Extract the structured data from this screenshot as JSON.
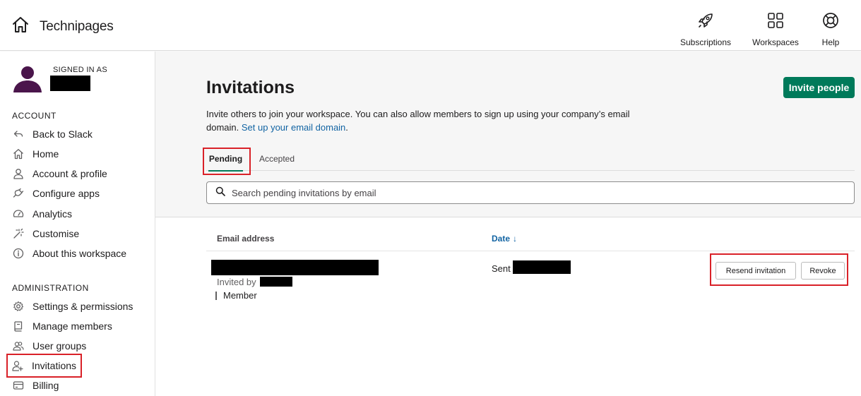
{
  "header": {
    "workspace_name": "Technipages",
    "home_icon": "home-icon",
    "nav": [
      {
        "label": "Subscriptions",
        "icon": "rocket-icon"
      },
      {
        "label": "Workspaces",
        "icon": "grid-icon"
      },
      {
        "label": "Help",
        "icon": "lifebuoy-icon"
      }
    ]
  },
  "sidebar": {
    "signed_in_label": "SIGNED IN AS",
    "account_heading": "ACCOUNT",
    "account_items": [
      {
        "label": "Back to Slack",
        "icon": "back-arrow-icon"
      },
      {
        "label": "Home",
        "icon": "home-icon"
      },
      {
        "label": "Account & profile",
        "icon": "person-icon"
      },
      {
        "label": "Configure apps",
        "icon": "plug-icon"
      },
      {
        "label": "Analytics",
        "icon": "gauge-icon"
      },
      {
        "label": "Customise",
        "icon": "magic-wand-icon"
      },
      {
        "label": "About this workspace",
        "icon": "info-icon"
      }
    ],
    "admin_heading": "ADMINISTRATION",
    "admin_items": [
      {
        "label": "Settings & permissions",
        "icon": "gear-icon"
      },
      {
        "label": "Manage members",
        "icon": "book-icon"
      },
      {
        "label": "User groups",
        "icon": "users-icon"
      },
      {
        "label": "Invitations",
        "icon": "add-person-icon"
      },
      {
        "label": "Billing",
        "icon": "credit-card-icon"
      }
    ],
    "active_item": "Invitations"
  },
  "main": {
    "title": "Invitations",
    "invite_button": "Invite people",
    "description_text": "Invite others to join your workspace. You can also allow members to sign up using your company’s email domain. ",
    "description_link": "Set up your email domain",
    "description_end": ".",
    "tabs": [
      {
        "label": "Pending",
        "active": true
      },
      {
        "label": "Accepted",
        "active": false
      }
    ],
    "search_placeholder": "Search pending invitations by email",
    "table": {
      "col_email": "Email address",
      "col_date": "Date",
      "rows": [
        {
          "invited_by_label": "Invited by",
          "role": "Member",
          "sent_label": "Sent",
          "resend_label": "Resend invitation",
          "revoke_label": "Revoke"
        }
      ]
    }
  },
  "colors": {
    "accent_green": "#007a5a",
    "link_blue": "#1264a3",
    "highlight_red": "#d92128",
    "avatar_purple": "#4a154b"
  }
}
